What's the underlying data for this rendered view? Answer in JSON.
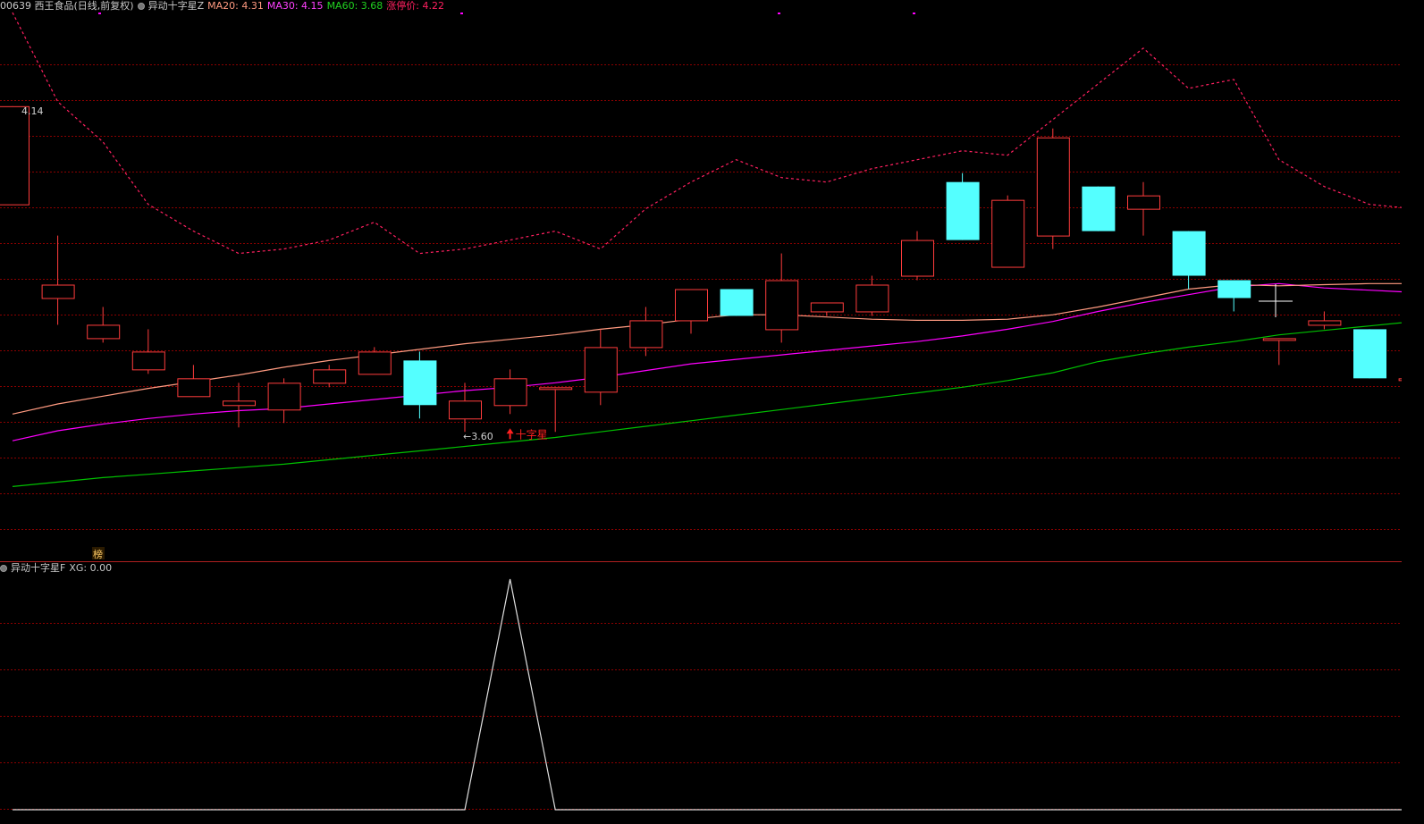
{
  "header": {
    "stock": "00639 西王食品(日线,前复权)",
    "indicator_name": "异动十字星Z",
    "ma20": "MA20: 4.31",
    "ma30": "MA30: 4.15",
    "ma60": "MA60: 3.68",
    "limit_up": "涨停价: 4.22"
  },
  "sub_header": {
    "indicator_name": "异动十字星F",
    "xg": "XG: 0.00"
  },
  "colors": {
    "up": "#ff3c3c",
    "down": "#54ffff",
    "ma20": "#ff9a80",
    "ma30": "#ff00ff",
    "ma60": "#00c000",
    "limit": "#ff2060",
    "grid": "#8b0000",
    "white": "#ffffff"
  },
  "annotations": {
    "high_label": "4.14",
    "low_label": "3.60",
    "signal_label": "十字星",
    "badge": "榜"
  },
  "chart_data": {
    "type": "candlestick",
    "ylim": [
      3.12,
      4.35
    ],
    "candles": [
      {
        "o": 3.92,
        "h": 4.14,
        "l": 3.92,
        "c": 4.14
      },
      {
        "o": 3.71,
        "h": 3.85,
        "l": 3.65,
        "c": 3.74
      },
      {
        "o": 3.62,
        "h": 3.69,
        "l": 3.61,
        "c": 3.65
      },
      {
        "o": 3.55,
        "h": 3.64,
        "l": 3.54,
        "c": 3.59
      },
      {
        "o": 3.49,
        "h": 3.56,
        "l": 3.49,
        "c": 3.53
      },
      {
        "o": 3.47,
        "h": 3.52,
        "l": 3.42,
        "c": 3.48
      },
      {
        "o": 3.46,
        "h": 3.53,
        "l": 3.43,
        "c": 3.52
      },
      {
        "o": 3.52,
        "h": 3.56,
        "l": 3.51,
        "c": 3.55
      },
      {
        "o": 3.54,
        "h": 3.6,
        "l": 3.54,
        "c": 3.59
      },
      {
        "o": 3.57,
        "h": 3.59,
        "l": 3.44,
        "c": 3.47
      },
      {
        "o": 3.44,
        "h": 3.52,
        "l": 3.41,
        "c": 3.48
      },
      {
        "o": 3.47,
        "h": 3.55,
        "l": 3.45,
        "c": 3.53
      },
      {
        "o": 3.51,
        "h": 3.51,
        "l": 3.41,
        "c": 3.51
      },
      {
        "o": 3.5,
        "h": 3.64,
        "l": 3.47,
        "c": 3.6
      },
      {
        "o": 3.6,
        "h": 3.69,
        "l": 3.58,
        "c": 3.66
      },
      {
        "o": 3.66,
        "h": 3.73,
        "l": 3.63,
        "c": 3.73
      },
      {
        "o": 3.73,
        "h": 3.73,
        "l": 3.67,
        "c": 3.67
      },
      {
        "o": 3.64,
        "h": 3.81,
        "l": 3.61,
        "c": 3.75
      },
      {
        "o": 3.68,
        "h": 3.7,
        "l": 3.67,
        "c": 3.7
      },
      {
        "o": 3.68,
        "h": 3.76,
        "l": 3.67,
        "c": 3.74
      },
      {
        "o": 3.76,
        "h": 3.86,
        "l": 3.75,
        "c": 3.84
      },
      {
        "o": 3.97,
        "h": 3.99,
        "l": 3.84,
        "c": 3.84
      },
      {
        "o": 3.78,
        "h": 3.94,
        "l": 3.78,
        "c": 3.93
      },
      {
        "o": 3.85,
        "h": 4.09,
        "l": 3.82,
        "c": 4.07
      },
      {
        "o": 3.96,
        "h": 3.96,
        "l": 3.86,
        "c": 3.86
      },
      {
        "o": 3.91,
        "h": 3.97,
        "l": 3.85,
        "c": 3.94
      },
      {
        "o": 3.86,
        "h": 3.86,
        "l": 3.73,
        "c": 3.76
      },
      {
        "o": 3.75,
        "h": 3.75,
        "l": 3.68,
        "c": 3.71
      },
      {
        "o": 3.62,
        "h": 3.62,
        "l": 3.56,
        "c": 3.62
      },
      {
        "o": 3.65,
        "h": 3.68,
        "l": 3.64,
        "c": 3.66
      },
      {
        "o": 3.64,
        "h": 3.64,
        "l": 3.53,
        "c": 3.53
      },
      {
        "o": 3.53,
        "h": 3.53,
        "l": 3.51,
        "c": 3.53
      }
    ],
    "ma20": [
      3.45,
      3.4725,
      3.49,
      3.5075,
      3.5225,
      3.5375,
      3.555,
      3.57,
      3.5825,
      3.595,
      3.6075,
      3.6175,
      3.6275,
      3.64,
      3.65,
      3.6625,
      3.6725,
      3.6725,
      3.6675,
      3.6625,
      3.66,
      3.66,
      3.6625,
      3.6725,
      3.69,
      3.71,
      3.73,
      3.74,
      3.7375,
      3.74,
      3.7425,
      3.7425
    ],
    "ma30": [
      3.39,
      3.4125,
      3.4275,
      3.44,
      3.45,
      3.4575,
      3.4625,
      3.4725,
      3.4825,
      3.4925,
      3.5025,
      3.51,
      3.52,
      3.5325,
      3.5475,
      3.5625,
      3.5725,
      3.5825,
      3.5925,
      3.6025,
      3.6125,
      3.625,
      3.64,
      3.6575,
      3.68,
      3.7,
      3.7175,
      3.735,
      3.7425,
      3.7325,
      3.7275,
      3.7225
    ],
    "ma60": [
      3.2875,
      3.2975,
      3.3075,
      3.315,
      3.3225,
      3.33,
      3.3375,
      3.3475,
      3.3575,
      3.3675,
      3.3775,
      3.3875,
      3.3975,
      3.41,
      3.4225,
      3.435,
      3.4475,
      3.46,
      3.4725,
      3.485,
      3.4975,
      3.51,
      3.525,
      3.5425,
      3.5675,
      3.585,
      3.6,
      3.6125,
      3.6275,
      3.6375,
      3.6475,
      3.6575
    ],
    "limit_price": [
      4.35,
      4.15,
      4.06,
      3.92,
      3.86,
      3.81,
      3.82,
      3.84,
      3.88,
      3.81,
      3.82,
      3.84,
      3.86,
      3.82,
      3.91,
      3.97,
      4.02,
      3.98,
      3.97,
      4.0,
      4.02,
      4.04,
      4.03,
      4.11,
      4.19,
      4.27,
      4.18,
      4.2,
      4.02,
      3.96,
      3.92,
      3.91
    ],
    "xg": [
      0,
      0,
      0,
      0,
      0,
      0,
      0,
      0,
      0,
      0,
      0,
      1,
      0,
      0,
      0,
      0,
      0,
      0,
      0,
      0,
      0,
      0,
      0,
      0,
      0,
      0,
      0,
      0,
      0,
      0,
      0,
      0
    ],
    "signal_index": 11,
    "high_index": 0,
    "low_index": 10
  }
}
